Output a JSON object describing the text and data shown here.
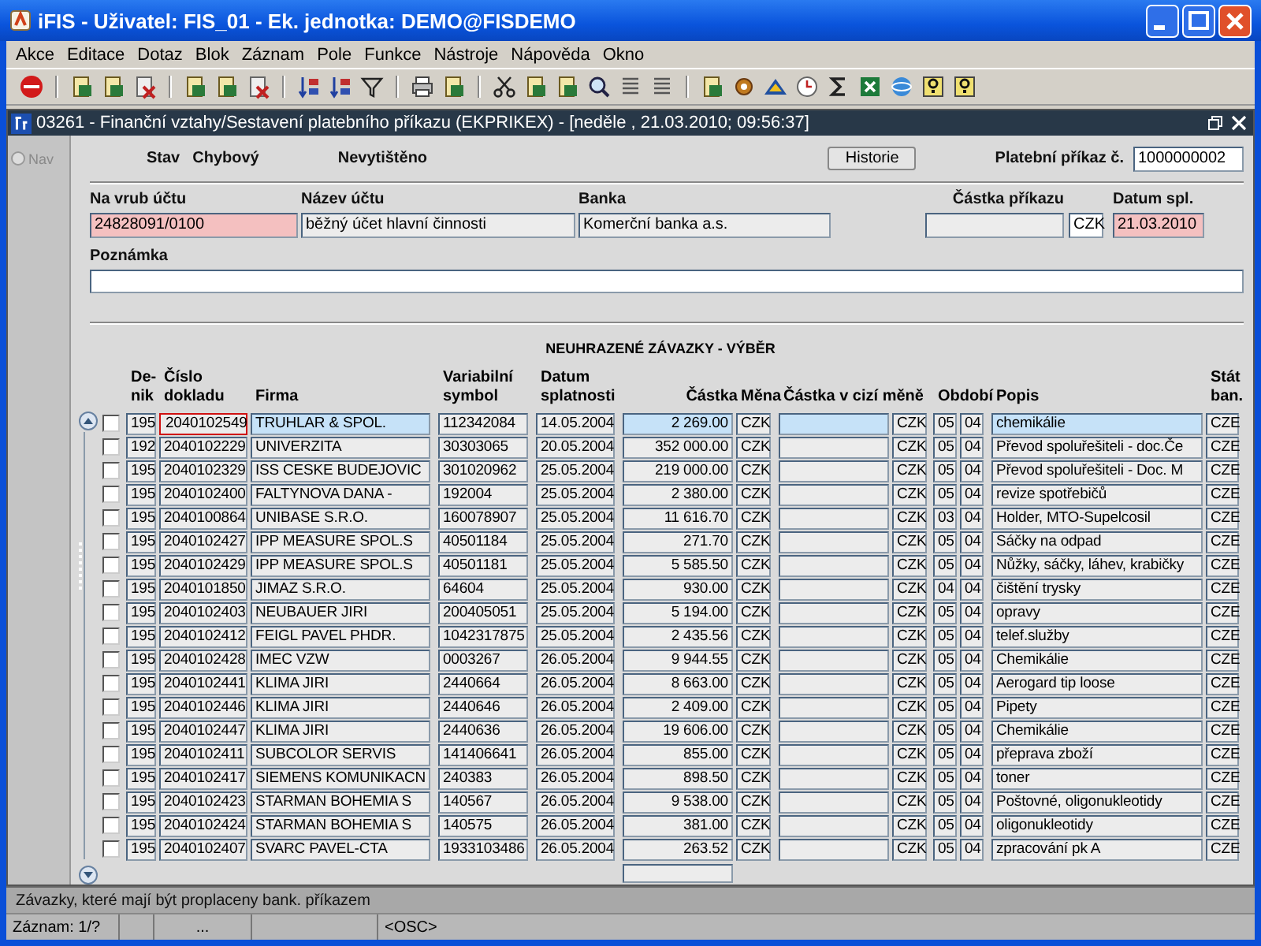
{
  "window": {
    "title": "iFIS - Uživatel: FIS_01 - Ek. jednotka: DEMO@FISDEMO"
  },
  "menu": [
    "Akce",
    "Editace",
    "Dotaz",
    "Blok",
    "Záznam",
    "Pole",
    "Funkce",
    "Nástroje",
    "Nápověda",
    "Okno"
  ],
  "form_window": {
    "title": "03261 - Finanční vztahy/Sestavení platebního příkazu (EKPRIKEX) - [neděle , 21.03.2010; 09:56:37]"
  },
  "nav": {
    "label": "Nav",
    "selected": false
  },
  "header": {
    "stav_label": "Stav",
    "stav": "Chybový",
    "tisk": "Nevytištěno",
    "history_button": "Historie",
    "prikaz_label": "Platební příkaz č.",
    "prikaz": "1000000002"
  },
  "fields": [
    {
      "label": "Na vrub účtu",
      "value": "24828091/0100",
      "required": true
    },
    {
      "label": "Název účtu",
      "value": "běžný účet hlavní činnosti",
      "required": false
    },
    {
      "label": "Banka",
      "value": "Komerční banka a.s.",
      "required": false
    },
    {
      "label": "Částka příkazu",
      "required": false
    },
    {
      "value": "CZK"
    },
    {
      "label": "Datum spl.",
      "value": "21.03.2010",
      "required": true
    }
  ],
  "note": {
    "label": "Poznámka"
  },
  "table": {
    "title": "NEUHRAZENÉ ZÁVAZKY - VÝBĚR",
    "columns": [
      "De-\nnik",
      "Číslo\ndokladu",
      "Firma",
      "Variabilní\nsymbol",
      "Datum\nsplatnosti",
      "Částka",
      "Měna",
      "Částka v cizí měně",
      "",
      "Období",
      "",
      "Popis",
      "Stát\nban."
    ],
    "rows": [
      {
        "selected": true,
        "checked": false,
        "cells": [
          "195",
          "2040102549",
          "TRUHLAR & SPOL.",
          "112342084",
          "14.05.2004",
          "2 269.00",
          "CZK",
          "",
          "CZK",
          "05",
          "04",
          "chemikálie",
          "CZE"
        ]
      },
      {
        "selected": false,
        "checked": false,
        "cells": [
          "192",
          "2040102229",
          "UNIVERZITA",
          "30303065",
          "20.05.2004",
          "352 000.00",
          "CZK",
          "",
          "CZK",
          "05",
          "04",
          "Převod spoluřešiteli - doc.Če",
          "CZE"
        ]
      },
      {
        "selected": false,
        "checked": false,
        "cells": [
          "195",
          "2040102329",
          "ISS CESKE BUDEJOVIC",
          "301020962",
          "25.05.2004",
          "219 000.00",
          "CZK",
          "",
          "CZK",
          "05",
          "04",
          "Převod spoluřešiteli - Doc. M",
          "CZE"
        ]
      },
      {
        "selected": false,
        "checked": false,
        "cells": [
          "195",
          "2040102400",
          "FALTYNOVA DANA -",
          "192004",
          "25.05.2004",
          "2 380.00",
          "CZK",
          "",
          "CZK",
          "05",
          "04",
          "revize spotřebičů",
          "CZE"
        ]
      },
      {
        "selected": false,
        "checked": false,
        "cells": [
          "195",
          "2040100864",
          "UNIBASE S.R.O.",
          "160078907",
          "25.05.2004",
          "11 616.70",
          "CZK",
          "",
          "CZK",
          "03",
          "04",
          "Holder, MTO-Supelcosil",
          "CZE"
        ]
      },
      {
        "selected": false,
        "checked": false,
        "cells": [
          "195",
          "2040102427",
          "IPP MEASURE SPOL.S",
          "40501184",
          "25.05.2004",
          "271.70",
          "CZK",
          "",
          "CZK",
          "05",
          "04",
          "Sáčky na odpad",
          "CZE"
        ]
      },
      {
        "selected": false,
        "checked": false,
        "cells": [
          "195",
          "2040102429",
          "IPP MEASURE SPOL.S",
          "40501181",
          "25.05.2004",
          "5 585.50",
          "CZK",
          "",
          "CZK",
          "05",
          "04",
          "Nůžky, sáčky, láhev, krabičky",
          "CZE"
        ]
      },
      {
        "selected": false,
        "checked": false,
        "cells": [
          "195",
          "2040101850",
          "JIMAZ S.R.O.",
          "64604",
          "25.05.2004",
          "930.00",
          "CZK",
          "",
          "CZK",
          "04",
          "04",
          "čištění trysky",
          "CZE"
        ]
      },
      {
        "selected": false,
        "checked": false,
        "cells": [
          "195",
          "2040102403",
          "NEUBAUER JIRI",
          "200405051",
          "25.05.2004",
          "5 194.00",
          "CZK",
          "",
          "CZK",
          "05",
          "04",
          "opravy",
          "CZE"
        ]
      },
      {
        "selected": false,
        "checked": false,
        "cells": [
          "195",
          "2040102412",
          "FEIGL PAVEL PHDR.",
          "1042317875",
          "25.05.2004",
          "2 435.56",
          "CZK",
          "",
          "CZK",
          "05",
          "04",
          "telef.služby",
          "CZE"
        ]
      },
      {
        "selected": false,
        "checked": false,
        "cells": [
          "195",
          "2040102428",
          "IMEC VZW",
          "0003267",
          "26.05.2004",
          "9 944.55",
          "CZK",
          "",
          "CZK",
          "05",
          "04",
          "Chemikálie",
          "CZE"
        ]
      },
      {
        "selected": false,
        "checked": false,
        "cells": [
          "195",
          "2040102441",
          "KLIMA JIRI",
          "2440664",
          "26.05.2004",
          "8 663.00",
          "CZK",
          "",
          "CZK",
          "05",
          "04",
          "Aerogard tip loose",
          "CZE"
        ]
      },
      {
        "selected": false,
        "checked": false,
        "cells": [
          "195",
          "2040102446",
          "KLIMA JIRI",
          "2440646",
          "26.05.2004",
          "2 409.00",
          "CZK",
          "",
          "CZK",
          "05",
          "04",
          "Pipety",
          "CZE"
        ]
      },
      {
        "selected": false,
        "checked": false,
        "cells": [
          "195",
          "2040102447",
          "KLIMA JIRI",
          "2440636",
          "26.05.2004",
          "19 606.00",
          "CZK",
          "",
          "CZK",
          "05",
          "04",
          "Chemikálie",
          "CZE"
        ]
      },
      {
        "selected": false,
        "checked": false,
        "cells": [
          "195",
          "2040102411",
          "SUBCOLOR SERVIS",
          "141406641",
          "26.05.2004",
          "855.00",
          "CZK",
          "",
          "CZK",
          "05",
          "04",
          "přeprava zboží",
          "CZE"
        ]
      },
      {
        "selected": false,
        "checked": false,
        "cells": [
          "195",
          "2040102417",
          "SIEMENS KOMUNIKACN",
          "240383",
          "26.05.2004",
          "898.50",
          "CZK",
          "",
          "CZK",
          "05",
          "04",
          "toner",
          "CZE"
        ]
      },
      {
        "selected": false,
        "checked": false,
        "cells": [
          "195",
          "2040102423",
          "STARMAN BOHEMIA S",
          "140567",
          "26.05.2004",
          "9 538.00",
          "CZK",
          "",
          "CZK",
          "05",
          "04",
          "Poštovné, oligonukleotidy",
          "CZE"
        ]
      },
      {
        "selected": false,
        "checked": false,
        "cells": [
          "195",
          "2040102424",
          "STARMAN BOHEMIA S",
          "140575",
          "26.05.2004",
          "381.00",
          "CZK",
          "",
          "CZK",
          "05",
          "04",
          "oligonukleotidy",
          "CZE"
        ]
      },
      {
        "selected": false,
        "checked": false,
        "cells": [
          "195",
          "2040102407",
          "SVARC PAVEL-CTA",
          "1933103486",
          "26.05.2004",
          "263.52",
          "CZK",
          "",
          "CZK",
          "05",
          "04",
          "zpracování pk A",
          "CZE"
        ]
      }
    ]
  },
  "hint": "Závazky, které mají být proplaceny bank. příkazem",
  "status_bar": [
    "Záznam: 1/?",
    "...",
    "<OSC>"
  ]
}
